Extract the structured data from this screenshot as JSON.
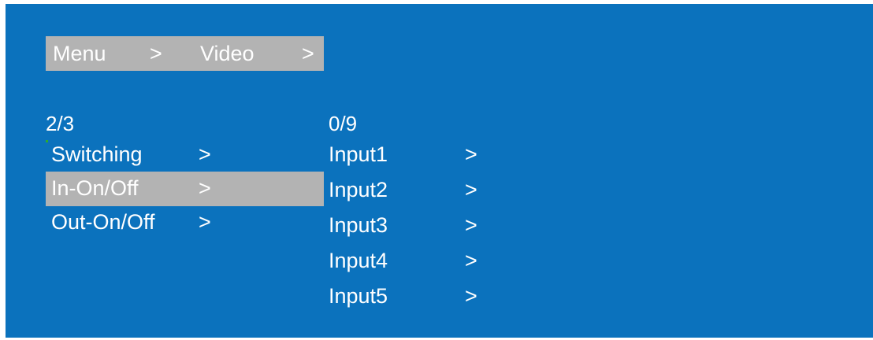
{
  "breadcrumb": {
    "root": "Menu",
    "sep1": ">",
    "current": "Video",
    "sep2": ">"
  },
  "left_menu": {
    "counter": "2/3",
    "selected_index": 1,
    "items": [
      {
        "label": "Switching",
        "arrow": ">"
      },
      {
        "label": "In-On/Off",
        "arrow": ">"
      },
      {
        "label": "Out-On/Off",
        "arrow": ">"
      }
    ]
  },
  "right_menu": {
    "counter": "0/9",
    "items": [
      {
        "label": "Input1",
        "arrow": ">"
      },
      {
        "label": "Input2",
        "arrow": ">"
      },
      {
        "label": "Input3",
        "arrow": ">"
      },
      {
        "label": "Input4",
        "arrow": ">"
      },
      {
        "label": "Input5",
        "arrow": ">"
      }
    ]
  },
  "colors": {
    "background": "#0b72bd",
    "highlight": "#b3b3b3",
    "text": "#ffffff"
  }
}
